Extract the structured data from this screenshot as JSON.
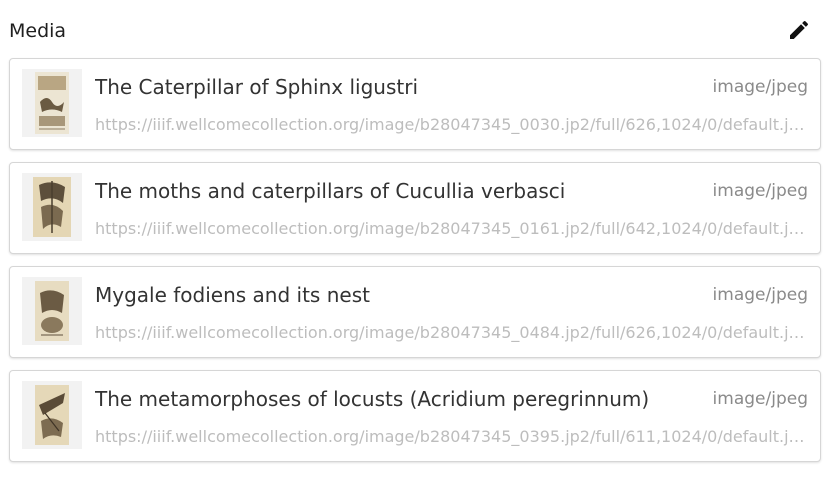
{
  "header": {
    "title": "Media",
    "edit_icon": "pencil-icon"
  },
  "items": [
    {
      "title": "The Caterpillar of Sphinx ligustri",
      "mime": "image/jpeg",
      "url": "https://iiif.wellcomecollection.org/image/b28047345_0030.jp2/full/626,1024/0/default.jpg",
      "thumb_bg": "#e9e1cf"
    },
    {
      "title": "The moths and caterpillars of Cucullia verbasci",
      "mime": "image/jpeg",
      "url": "https://iiif.wellcomecollection.org/image/b28047345_0161.jp2/full/642,1024/0/default.jpg",
      "thumb_bg": "#e4d6b4"
    },
    {
      "title": "Mygale fodiens and its nest",
      "mime": "image/jpeg",
      "url": "https://iiif.wellcomecollection.org/image/b28047345_0484.jp2/full/626,1024/0/default.jpg",
      "thumb_bg": "#e7dcc1"
    },
    {
      "title": "The metamorphoses of locusts (Acridium peregrinnum)",
      "mime": "image/jpeg",
      "url": "https://iiif.wellcomecollection.org/image/b28047345_0395.jp2/full/611,1024/0/default.jpg",
      "thumb_bg": "#e5d8b8"
    }
  ]
}
